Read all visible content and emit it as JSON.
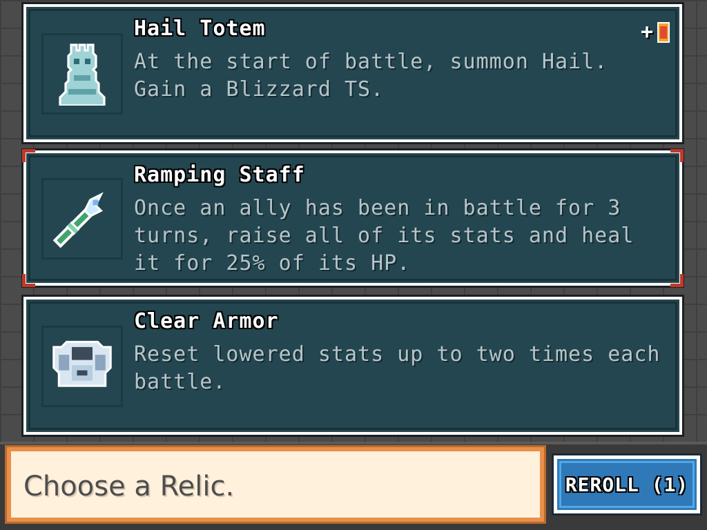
{
  "relics": [
    {
      "name": "Hail Totem",
      "description": "At the start of battle, summon Hail. Gain a Blizzard TS.",
      "icon": "ice-totem-icon",
      "badge": "+",
      "selected": false
    },
    {
      "name": "Ramping Staff",
      "description": "Once an ally has been in battle for 3 turns, raise all of its stats and heal it for 25% of its HP.",
      "icon": "staff-icon",
      "selected": true
    },
    {
      "name": "Clear Armor",
      "description": "Reset lowered stats up to two times each battle.",
      "icon": "armor-icon",
      "selected": false
    }
  ],
  "message": "Choose a Relic.",
  "reroll_label": "REROLL (1)",
  "colors": {
    "card_bg": "#244650",
    "selection_corner": "#c0392b",
    "message_border": "#e98f4a",
    "reroll_bg": "#2f79b8"
  }
}
